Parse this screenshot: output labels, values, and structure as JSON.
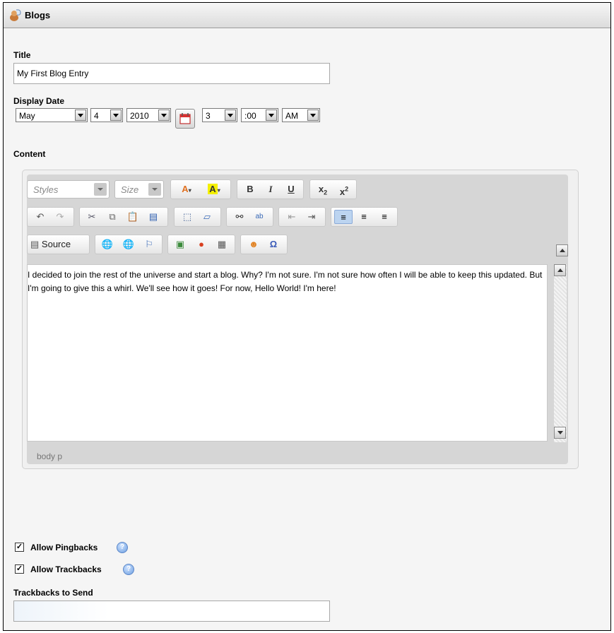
{
  "header": {
    "title": "Blogs",
    "icon": "blog-icon"
  },
  "title_field": {
    "label": "Title",
    "value": "My First Blog Entry"
  },
  "display_date": {
    "label": "Display Date",
    "month": "May",
    "day": "4",
    "year": "2010",
    "hour": "3",
    "minute": ":00",
    "ampm": "AM"
  },
  "content": {
    "label": "Content",
    "toolbar": {
      "styles_placeholder": "Styles",
      "size_placeholder": "Size",
      "bold": "B",
      "italic": "I",
      "underline": "U",
      "source_label": "Source"
    },
    "text": "I decided to join the rest of the universe and start a blog. Why? I'm not sure. I'm not sure how often I will be able to keep this updated. But I'm going to give this a whirl. We'll see how it goes! For now, Hello World! I'm here!",
    "path": "body  p"
  },
  "options": {
    "pingbacks": {
      "label": "Allow Pingbacks",
      "checked": true
    },
    "trackbacks": {
      "label": "Allow Trackbacks",
      "checked": true
    }
  },
  "trackbacks_to_send": {
    "label": "Trackbacks to Send",
    "value": ""
  }
}
